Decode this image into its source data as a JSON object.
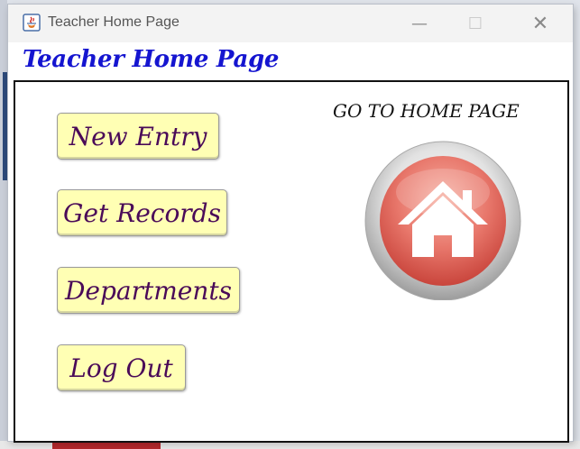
{
  "window": {
    "title": "Teacher Home Page",
    "controls": {
      "minimize": "—",
      "maximize": "☐",
      "close": "✕"
    }
  },
  "page": {
    "heading": "Teacher Home Page"
  },
  "menu": {
    "new_entry": "New Entry",
    "get_records": "Get Records",
    "departments": "Departments",
    "log_out": "Log Out"
  },
  "home": {
    "label": "GO TO HOME PAGE",
    "icon": "house-icon"
  },
  "colors": {
    "heading": "#1515d0",
    "button_bg": "#ffffb4",
    "button_text": "#4a0a58",
    "home_button": "#e8776b"
  }
}
